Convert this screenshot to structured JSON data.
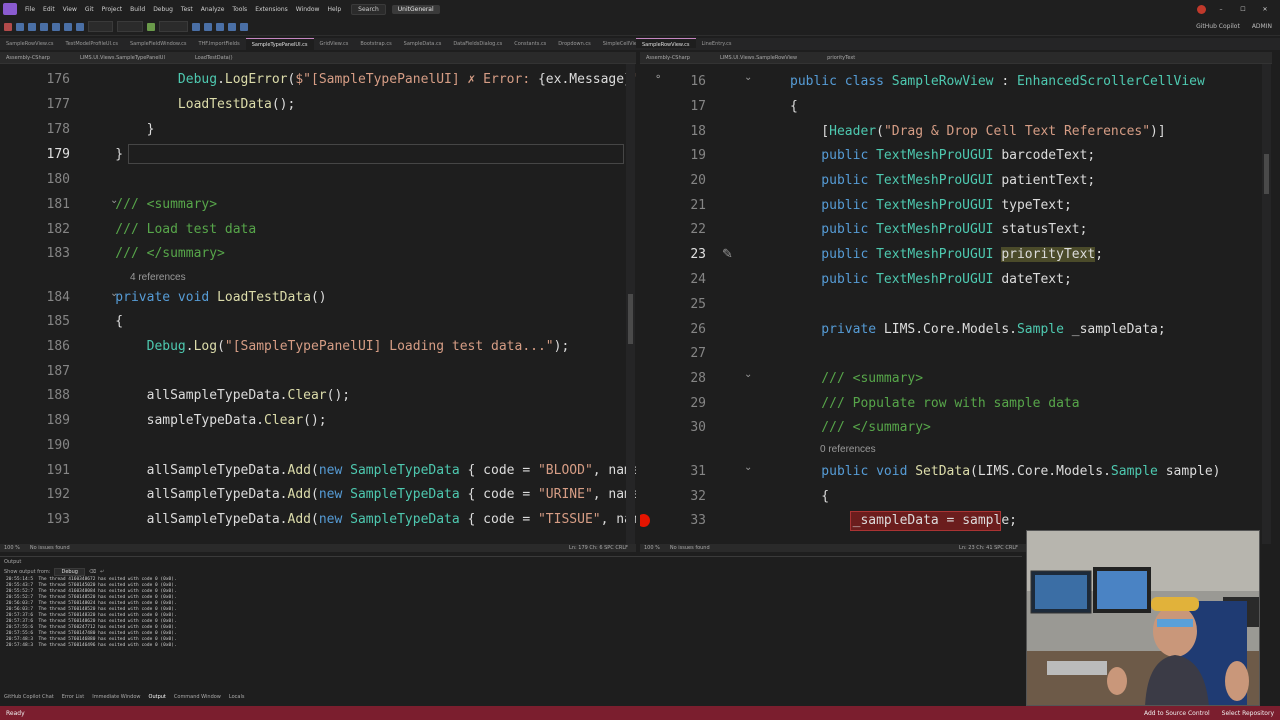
{
  "menu": {
    "items": [
      "File",
      "Edit",
      "View",
      "Git",
      "Project",
      "Build",
      "Debug",
      "Test",
      "Analyze",
      "Tools",
      "Extensions",
      "Window",
      "Help"
    ],
    "search": "Search",
    "solution": "UnitGeneral",
    "user": "ADMIN",
    "copilot": "GitHub Copilot"
  },
  "file_tabs_left": [
    "SampleRowView.cs",
    "TestModelProfileUI.cs",
    "SampleFieldWindow.cs",
    "THF.ImportFields",
    "SampleTypePanelUI.cs",
    "GridView.cs",
    "Bootstrap.cs",
    "SampleData.cs",
    "DataFieldsDialog.cs",
    "Constants.cs",
    "Dropdown.cs",
    "SimpleCellViewHandler.cs"
  ],
  "file_tabs_right": [
    "SampleRowView.cs",
    "LineEntry.cs"
  ],
  "left_editor": {
    "nav": [
      "Assembly-CSharp",
      "LIMS.UI.Views.SampleTypePanelUI",
      "LoadTestData()"
    ],
    "refs_label": "4 references",
    "lines": [
      {
        "num": "176",
        "tokens": [
          {
            "c": "tx",
            "t": "            "
          },
          {
            "c": "ty",
            "t": "Debug"
          },
          {
            "c": "tx",
            "t": "."
          },
          {
            "c": "mth",
            "t": "LogError"
          },
          {
            "c": "tx",
            "t": "("
          },
          {
            "c": "str",
            "t": "$\"[SampleTypePanelUI] ✗ Error: "
          },
          {
            "c": "tx",
            "t": "{ex.Message}"
          },
          {
            "c": "str",
            "t": "\""
          }
        ]
      },
      {
        "num": "177",
        "tokens": [
          {
            "c": "tx",
            "t": "            "
          },
          {
            "c": "mth",
            "t": "LoadTestData"
          },
          {
            "c": "tx",
            "t": "();"
          }
        ]
      },
      {
        "num": "178",
        "tokens": [
          {
            "c": "tx",
            "t": "        }"
          }
        ]
      },
      {
        "num": "179",
        "tokens": [
          {
            "c": "tx",
            "t": "    }"
          }
        ]
      },
      {
        "num": "180",
        "tokens": []
      },
      {
        "num": "181",
        "tokens": [
          {
            "c": "cm",
            "t": "    /// <summary>"
          }
        ]
      },
      {
        "num": "182",
        "tokens": [
          {
            "c": "cm",
            "t": "    /// Load test data"
          }
        ]
      },
      {
        "num": "183",
        "tokens": [
          {
            "c": "cm",
            "t": "    /// </summary>"
          }
        ]
      },
      {
        "num": "184",
        "tokens": [
          {
            "c": "kw",
            "t": "    private void "
          },
          {
            "c": "mth",
            "t": "LoadTestData"
          },
          {
            "c": "tx",
            "t": "()"
          }
        ]
      },
      {
        "num": "185",
        "tokens": [
          {
            "c": "tx",
            "t": "    {"
          }
        ]
      },
      {
        "num": "186",
        "tokens": [
          {
            "c": "tx",
            "t": "        "
          },
          {
            "c": "ty",
            "t": "Debug"
          },
          {
            "c": "tx",
            "t": "."
          },
          {
            "c": "mth",
            "t": "Log"
          },
          {
            "c": "tx",
            "t": "("
          },
          {
            "c": "str",
            "t": "\"[SampleTypePanelUI] Loading test data...\""
          },
          {
            "c": "tx",
            "t": ");"
          }
        ]
      },
      {
        "num": "187",
        "tokens": []
      },
      {
        "num": "188",
        "tokens": [
          {
            "c": "tx",
            "t": "        allSampleTypeData."
          },
          {
            "c": "mth",
            "t": "Clear"
          },
          {
            "c": "tx",
            "t": "();"
          }
        ]
      },
      {
        "num": "189",
        "tokens": [
          {
            "c": "tx",
            "t": "        sampleTypeData."
          },
          {
            "c": "mth",
            "t": "Clear"
          },
          {
            "c": "tx",
            "t": "();"
          }
        ]
      },
      {
        "num": "190",
        "tokens": []
      },
      {
        "num": "191",
        "tokens": [
          {
            "c": "tx",
            "t": "        allSampleTypeData."
          },
          {
            "c": "mth",
            "t": "Add"
          },
          {
            "c": "tx",
            "t": "("
          },
          {
            "c": "kw",
            "t": "new "
          },
          {
            "c": "ty",
            "t": "SampleTypeData"
          },
          {
            "c": "tx",
            "t": " { code = "
          },
          {
            "c": "str",
            "t": "\"BLOOD\""
          },
          {
            "c": "tx",
            "t": ", name ="
          }
        ]
      },
      {
        "num": "192",
        "tokens": [
          {
            "c": "tx",
            "t": "        allSampleTypeData."
          },
          {
            "c": "mth",
            "t": "Add"
          },
          {
            "c": "tx",
            "t": "("
          },
          {
            "c": "kw",
            "t": "new "
          },
          {
            "c": "ty",
            "t": "SampleTypeData"
          },
          {
            "c": "tx",
            "t": " { code = "
          },
          {
            "c": "str",
            "t": "\"URINE\""
          },
          {
            "c": "tx",
            "t": ", name ="
          }
        ]
      },
      {
        "num": "193",
        "tokens": [
          {
            "c": "tx",
            "t": "        allSampleTypeData."
          },
          {
            "c": "mth",
            "t": "Add"
          },
          {
            "c": "tx",
            "t": "("
          },
          {
            "c": "kw",
            "t": "new "
          },
          {
            "c": "ty",
            "t": "SampleTypeData"
          },
          {
            "c": "tx",
            "t": " { code = "
          },
          {
            "c": "str",
            "t": "\"TISSUE\""
          },
          {
            "c": "tx",
            "t": ", name"
          }
        ]
      }
    ]
  },
  "right_editor": {
    "nav": [
      "Assembly-CSharp",
      "LIMS.UI.Views.SampleRowView",
      "priorityText"
    ],
    "refs_label": "0 references",
    "lines": [
      {
        "num": "16",
        "tokens": [
          {
            "c": "kw",
            "t": "public class "
          },
          {
            "c": "ty",
            "t": "SampleRowView"
          },
          {
            "c": "tx",
            "t": " : "
          },
          {
            "c": "ty",
            "t": "EnhancedScrollerCellView"
          }
        ]
      },
      {
        "num": "17",
        "tokens": [
          {
            "c": "tx",
            "t": "{"
          }
        ]
      },
      {
        "num": "18",
        "tokens": [
          {
            "c": "tx",
            "t": "    ["
          },
          {
            "c": "attr",
            "t": "Header"
          },
          {
            "c": "tx",
            "t": "("
          },
          {
            "c": "str",
            "t": "\"Drag & Drop Cell Text References\""
          },
          {
            "c": "tx",
            "t": ")]"
          }
        ]
      },
      {
        "num": "19",
        "tokens": [
          {
            "c": "kw",
            "t": "    public "
          },
          {
            "c": "ty",
            "t": "TextMeshProUGUI"
          },
          {
            "c": "tx",
            "t": " barcodeText;"
          }
        ]
      },
      {
        "num": "20",
        "tokens": [
          {
            "c": "kw",
            "t": "    public "
          },
          {
            "c": "ty",
            "t": "TextMeshProUGUI"
          },
          {
            "c": "tx",
            "t": " patientText;"
          }
        ]
      },
      {
        "num": "21",
        "tokens": [
          {
            "c": "kw",
            "t": "    public "
          },
          {
            "c": "ty",
            "t": "TextMeshProUGUI"
          },
          {
            "c": "tx",
            "t": " typeText;"
          }
        ]
      },
      {
        "num": "22",
        "tokens": [
          {
            "c": "kw",
            "t": "    public "
          },
          {
            "c": "ty",
            "t": "TextMeshProUGUI"
          },
          {
            "c": "tx",
            "t": " statusText;"
          }
        ]
      },
      {
        "num": "23",
        "tokens": [
          {
            "c": "kw",
            "t": "    public "
          },
          {
            "c": "ty",
            "t": "TextMeshProUGUI"
          },
          {
            "c": "tx",
            "t": " "
          },
          {
            "c": "hl",
            "t": "priorityText"
          },
          {
            "c": "tx",
            "t": ";"
          }
        ]
      },
      {
        "num": "24",
        "tokens": [
          {
            "c": "kw",
            "t": "    public "
          },
          {
            "c": "ty",
            "t": "TextMeshProUGUI"
          },
          {
            "c": "tx",
            "t": " dateText;"
          }
        ]
      },
      {
        "num": "25",
        "tokens": []
      },
      {
        "num": "26",
        "tokens": [
          {
            "c": "kw",
            "t": "    private "
          },
          {
            "c": "tx",
            "t": "LIMS.Core.Models."
          },
          {
            "c": "ty",
            "t": "Sample"
          },
          {
            "c": "tx",
            "t": " _sampleData;"
          }
        ]
      },
      {
        "num": "27",
        "tokens": []
      },
      {
        "num": "28",
        "tokens": [
          {
            "c": "cm",
            "t": "    /// <summary>"
          }
        ]
      },
      {
        "num": "29",
        "tokens": [
          {
            "c": "cm",
            "t": "    /// Populate row with sample data"
          }
        ]
      },
      {
        "num": "30",
        "tokens": [
          {
            "c": "cm",
            "t": "    /// </summary>"
          }
        ]
      },
      {
        "num": "31",
        "tokens": [
          {
            "c": "kw",
            "t": "    public void "
          },
          {
            "c": "mth",
            "t": "SetData"
          },
          {
            "c": "tx",
            "t": "(LIMS.Core.Models."
          },
          {
            "c": "ty",
            "t": "Sample"
          },
          {
            "c": "tx",
            "t": " sample)"
          }
        ]
      },
      {
        "num": "32",
        "tokens": [
          {
            "c": "tx",
            "t": "    {"
          }
        ]
      },
      {
        "num": "33",
        "tokens": [
          {
            "c": "tx",
            "t": "        "
          },
          {
            "c": "bp",
            "t": "_sampleData = sample;"
          }
        ]
      }
    ]
  },
  "left_status": {
    "zoom": "100 %",
    "issues": "No issues found",
    "pos": "Ln: 179  Ch: 6  SPC  CRLF"
  },
  "right_status": {
    "zoom": "100 %",
    "issues": "No issues found",
    "pos": "Ln: 23  Ch: 41  SPC  CRLF"
  },
  "output": {
    "title": "Output",
    "show_from_label": "Show output from:",
    "source": "Debug",
    "lines": [
      "20:55:14:5  The thread 4160348672 has exited with code 0 (0x0).",
      "20:55:43:7  The thread 5760145020 has exited with code 0 (0x0).",
      "20:55:52:7  The thread 4160348084 has exited with code 0 (0x0).",
      "20:55:52:7  The thread 5760148520 has exited with code 0 (0x0).",
      "20:56:03:7  The thread 5760148024 has exited with code 0 (0x0).",
      "20:56:03:7  The thread 5760148520 has exited with code 0 (0x0).",
      "20:57:37:6  The thread 5760148320 has exited with code 0 (0x0).",
      "20:57:37:6  The thread 5760148620 has exited with code 0 (0x0).",
      "20:57:55:6  The thread 5760247712 has exited with code 0 (0x0).",
      "20:57:55:6  The thread 5760147480 has exited with code 0 (0x0).",
      "20:57:48:3  The thread 5760146880 has exited with code 0 (0x0).",
      "20:57:48:3  The thread 5760146496 has exited with code 0 (0x0)."
    ]
  },
  "bottom_tabs": [
    "GitHub Copilot Chat",
    "Error List",
    "Immediate Window",
    "Output",
    "Command Window",
    "Locals"
  ],
  "statusbar": {
    "left": "Ready",
    "right": [
      "Add to Source Control",
      "Select Repository"
    ]
  },
  "colors": {
    "statusbar": "#7b1e2e",
    "breakpoint": "#e51400",
    "keyword": "#569cd6",
    "type": "#4ec9b0",
    "string": "#d69d85",
    "comment": "#57a64a",
    "method": "#dcdcaa"
  }
}
